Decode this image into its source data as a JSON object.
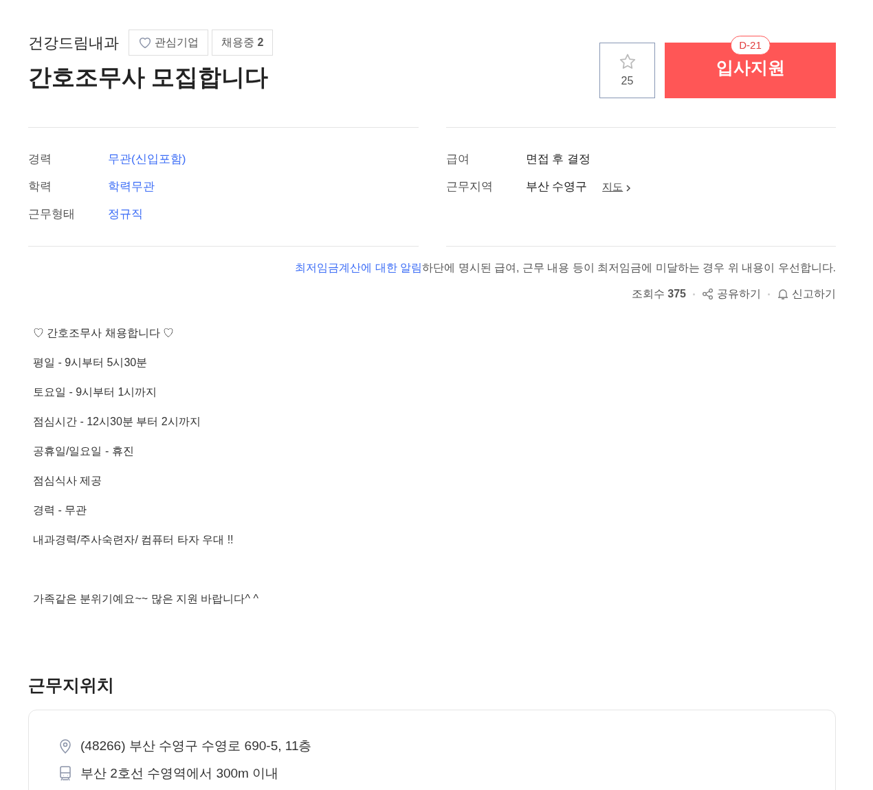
{
  "header": {
    "company": "건강드림내과",
    "follow_label": "관심기업",
    "hiring_badge": "채용중 **2**",
    "title": "간호조무사 모집합니다",
    "star_count": "25",
    "deadline": "D-21",
    "apply_label": "입사지원"
  },
  "summary_left": [
    {
      "label": "경력",
      "value": "무관(신입포함)"
    },
    {
      "label": "학력",
      "value": "학력무관"
    },
    {
      "label": "근무형태",
      "value": "정규직"
    }
  ],
  "summary_right": [
    {
      "label": "급여",
      "value": "면접 후 결정"
    },
    {
      "label": "근무지역",
      "value": "부산 수영구",
      "link": "지도"
    }
  ],
  "notice": {
    "link": "최저임금계산에 대한 알림",
    "text": "하단에 명시된 급여, 근무 내용 등이 최저임금에 미달하는 경우 위 내용이 우선합니다."
  },
  "stats": {
    "views": "조회수 **375**",
    "share": "공유하기",
    "report": "신고하기"
  },
  "description": [
    "♡ 간호조무사 채용합니다 ♡",
    "평일 - 9시부터 5시30분",
    "토요일 - 9시부터 1시까지",
    "점심시간 - 12시30분 부터 2시까지",
    "공휴일/일요일 - 휴진",
    "점심식사 제공",
    "경력 - 무관",
    "내과경력/주사숙련자/ 컴퓨터 타자 우대 !!"
  ],
  "closing": "가족같은 분위기예요~~ 많은 지원 바랍니다^ ^",
  "location": {
    "title": "근무지위치",
    "address": "(48266) 부산 수영구 수영로 690-5, 11층",
    "station": "부산 2호선 수영역에서 300m 이내"
  }
}
